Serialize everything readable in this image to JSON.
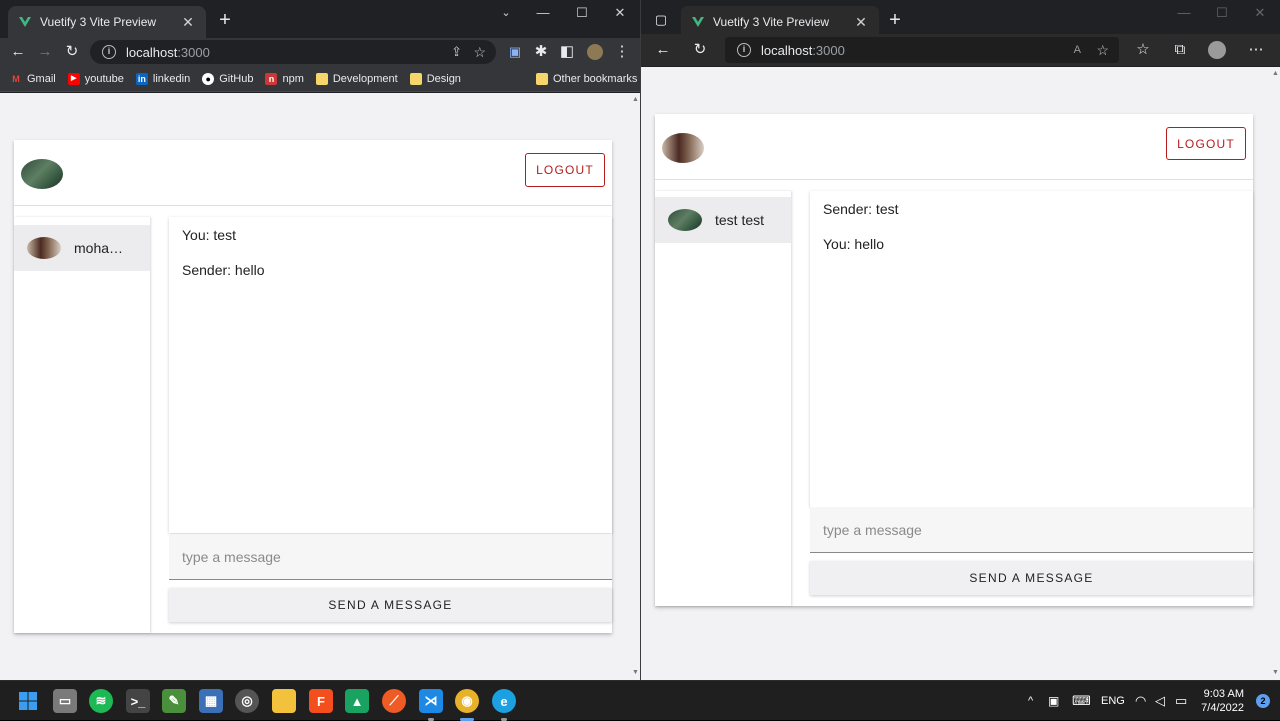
{
  "chrome": {
    "tab_title": "Vuetify 3 Vite Preview",
    "url_host": "localhost",
    "url_port": ":3000",
    "bookmarks": [
      {
        "label": "Gmail",
        "icon": "gmail-icon",
        "color": "#ea4335"
      },
      {
        "label": "youtube",
        "icon": "youtube-icon",
        "color": "#ff0000"
      },
      {
        "label": "linkedin",
        "icon": "linkedin-icon",
        "color": "#0a66c2"
      },
      {
        "label": "GitHub",
        "icon": "github-icon",
        "color": "#ffffff"
      },
      {
        "label": "npm",
        "icon": "npm-icon",
        "color": "#cb3837"
      },
      {
        "label": "Development",
        "icon": "folder-icon",
        "color": "#f6d56b"
      },
      {
        "label": "Design",
        "icon": "folder-icon",
        "color": "#f6d56b"
      }
    ],
    "other_bookmarks": "Other bookmarks",
    "app": {
      "logout_label": "LOGOUT",
      "contact_name": "mohammed",
      "messages": [
        "You: test",
        "Sender: hello"
      ],
      "input_placeholder": "type a message",
      "send_label": "SEND A MESSAGE"
    }
  },
  "edge": {
    "tab_title": "Vuetify 3 Vite Preview",
    "url_host": "localhost",
    "url_port": ":3000",
    "app": {
      "logout_label": "LOGOUT",
      "contact_name": "test test",
      "messages": [
        "Sender: test",
        "You: hello"
      ],
      "input_placeholder": "type a message",
      "send_label": "SEND A MESSAGE"
    }
  },
  "taskbar": {
    "apps": [
      {
        "name": "windows-start-icon",
        "color": "#3b9cf0"
      },
      {
        "name": "file-explorer-icon",
        "color": "#7a7a7a"
      },
      {
        "name": "spotify-icon",
        "color": "#1db954"
      },
      {
        "name": "terminal-icon",
        "color": "#444444"
      },
      {
        "name": "notepad-icon",
        "color": "#4a8f3c"
      },
      {
        "name": "calculator-icon",
        "color": "#3b6fb6"
      },
      {
        "name": "obs-icon",
        "color": "#555555"
      },
      {
        "name": "folder-icon",
        "color": "#f3c23c"
      },
      {
        "name": "figma-icon",
        "color": "#f24e1e"
      },
      {
        "name": "vuetify-icon",
        "color": "#1aa260"
      },
      {
        "name": "postman-icon",
        "color": "#ef5b25"
      },
      {
        "name": "vscode-icon",
        "color": "#1e88e5"
      },
      {
        "name": "chrome-icon",
        "color": "#e8b12a"
      },
      {
        "name": "edge-icon",
        "color": "#1ba1e2"
      }
    ],
    "lang": "ENG",
    "time": "9:03 AM",
    "date": "7/4/2022",
    "notifications": "2"
  }
}
